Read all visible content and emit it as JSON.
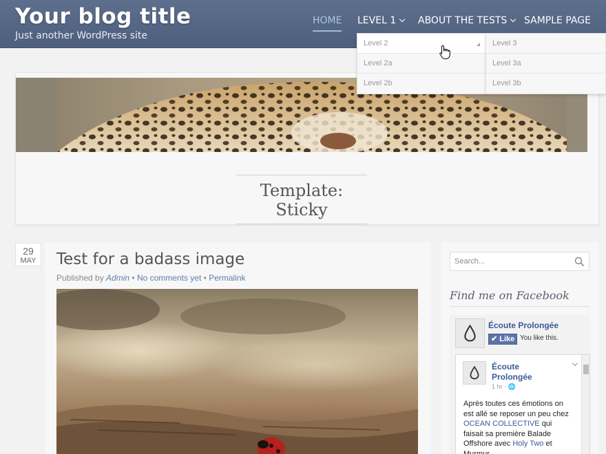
{
  "header": {
    "site_title": "Your blog title",
    "tagline": "Just another WordPress site"
  },
  "nav": {
    "items": [
      {
        "label": "HOME",
        "active": true
      },
      {
        "label": "LEVEL 1",
        "has_submenu": true
      },
      {
        "label": "ABOUT THE TESTS",
        "has_submenu": true
      },
      {
        "label": "SAMPLE PAGE"
      }
    ],
    "active_color": "#a9c6e6"
  },
  "dropdown": {
    "level2": [
      "Level 2",
      "Level 2a",
      "Level 2b"
    ],
    "level3": [
      "Level 3",
      "Level 3a",
      "Level 3b"
    ]
  },
  "hero": {
    "page_title": "Template: Sticky"
  },
  "post": {
    "date_day": "29",
    "date_month": "MAY",
    "title": "Test for a badass image",
    "meta_prefix": "Published by ",
    "author": "Admin",
    "sep1": " • ",
    "comments": "No comments yet",
    "sep2": " • ",
    "permalink": "Permalink"
  },
  "sidebar": {
    "search_placeholder": "Search...",
    "widget_title": "Find me on Facebook",
    "page_name": "Écoute Prolongée",
    "like_label": "Like",
    "like_text": "You like this.",
    "post_author_line1": "Écoute",
    "post_author_line2": "Prolongée",
    "post_time": "1 hr · ",
    "post_text_1": "Après toutes ces émotions on est allé se reposer un peu chez ",
    "post_link_1": "OCEAN COLLECTIVE",
    "post_text_2": " qui faisait sa première Balade Offshore avec ",
    "post_link_2": "Holy Two",
    "post_text_3": " et Murmur",
    "facebook_blue": "#3b5998"
  },
  "colors": {
    "header_bg": "#56688a",
    "accent_link": "#5b7fa8"
  }
}
